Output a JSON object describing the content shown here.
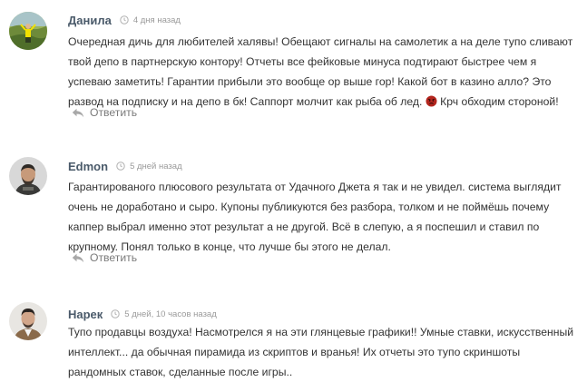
{
  "comments": [
    {
      "author": "Данила",
      "date": "4 дня назад",
      "text_before_emoji": "Очередная дичь для любителей халявы! Обещают сигналы на самолетик а на деле тупо сливают твой депо в партнерскую контору! Отчеты все фейковые минуса подтирают быстрее чем я успеваю заметить! Гарантии прибыли это вообще ор выше гор! Какой бот в казино алло? Это развод на подписку и на депо в бк! Саппорт молчит как рыба об лед. ",
      "text_after_emoji": " Крч обходим стороной!",
      "emoji_icon": "angry-face-emoji",
      "reply_label": "Ответить"
    },
    {
      "author": "Edmon",
      "date": "5 дней назад",
      "text": "Гарантированого плюсового результата от Удачного Джета я так и не увидел. система выглядит очень не доработано и сыро. Купоны публикуются без разбора, толком и не поймёшь почему каппер выбрал именно этот результат а не другой. Всё в слепую, а я поспешил и ставил по крупному. Понял только в конце, что лучше бы этого не делал.",
      "reply_label": "Ответить"
    },
    {
      "author": "Нарек",
      "date": "5 дней, 10 часов назад",
      "text": "Тупо продавцы воздуха! Насмотрелся я на эти глянцевые графики!! Умные ставки, искусственный интеллект... да обычная пирамида из скриптов и вранья! Их отчеты это тупо скриншоты рандомных ставок, сделанные после игры.."
    }
  ],
  "colors": {
    "author": "#4a5a6a",
    "text": "#333333",
    "meta": "#9a9a9a",
    "reply": "#7a7a7a"
  }
}
